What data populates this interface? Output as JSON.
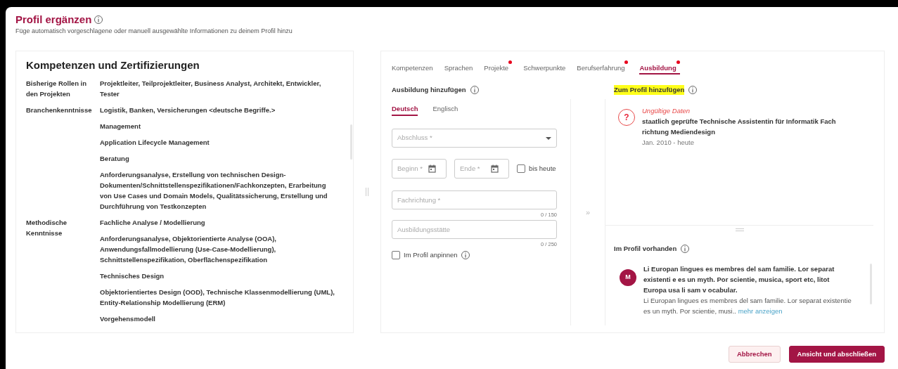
{
  "header": {
    "title": "Profil ergänzen",
    "subtitle": "Füge automatisch vorgeschlagene oder manuell ausgewählte Informationen zu deinem Profil hinzu"
  },
  "competences": {
    "title": "Kompetenzen und Zertifizierungen",
    "groups": [
      {
        "label": "Bisherige Rollen in den Projekten",
        "items": [
          "Projektleiter, Teilprojektleiter, Business Analyst, Architekt, Entwickler, Tester"
        ]
      },
      {
        "label": "Branchenkenntnisse",
        "items": [
          "Logistik, Banken, Versicherungen <deutsche Begriffe.>",
          "Management",
          "Application Lifecycle Management",
          "Beratung",
          "Anforderungsanalyse, Erstellung von technischen Design-Dokumenten/Schnittstellenspezifikationen/Fachkonzepten, Erarbeitung von Use Cases und Domain Models, Qualitätssicherung, Erstellung und Durchführung von Testkonzepten"
        ]
      },
      {
        "label": "Methodische Kenntnisse",
        "items": [
          "Fachliche Analyse / Modellierung",
          "Anforderungsanalyse, Objektorientierte Analyse (OOA), Anwendungsfallmodellierung (Use-Case-Modellierung), Schnittstellenspezifikation, Oberflächenspezifikation",
          "Technisches Design",
          "Objektorientiertes Design (OOD), Technische Klassenmodellierung (UML), Entity-Relationship Modellierung (ERM)",
          "Vorgehensmodell"
        ]
      }
    ]
  },
  "tabs": [
    {
      "label": "Kompetenzen",
      "selected": false,
      "alert": false
    },
    {
      "label": "Sprachen",
      "selected": false,
      "alert": false
    },
    {
      "label": "Projekte",
      "selected": false,
      "alert": true
    },
    {
      "label": "Schwerpunkte",
      "selected": false,
      "alert": false
    },
    {
      "label": "Berufserfahrung",
      "selected": false,
      "alert": true
    },
    {
      "label": "Ausbildung",
      "selected": true,
      "alert": true
    }
  ],
  "form": {
    "title": "Ausbildung hinzufügen",
    "languages": [
      {
        "label": "Deutsch",
        "selected": true
      },
      {
        "label": "Englisch",
        "selected": false
      }
    ],
    "degree": {
      "placeholder": "Abschluss *"
    },
    "start": {
      "placeholder": "Beginn *"
    },
    "end": {
      "placeholder": "Ende *"
    },
    "until_today": {
      "label": "bis heute",
      "checked": false
    },
    "field": {
      "placeholder": "Fachrichtung *",
      "counter": "0 / 150"
    },
    "school": {
      "placeholder": "Ausbildungsstätte",
      "counter": "0 / 250"
    },
    "pin": {
      "label": "Im Profil anpinnen",
      "checked": false
    }
  },
  "transfer": {
    "label": "»"
  },
  "to_add": {
    "title": "Zum Profil hinzufügen",
    "entries": [
      {
        "icon": "?",
        "status": "Ungültige Daten",
        "title": "staatlich geprüfte Technische Assistentin für Informatik Fach richtung Mediendesign",
        "period": "Jan. 2010 - heute"
      }
    ]
  },
  "existing": {
    "title": "Im Profil vorhanden",
    "entries": [
      {
        "avatar": "M",
        "title": "Li Europan lingues es membres del sam familie. Lor separat existenti e es un myth. Por scientie, musica, sport etc, litot Europa usa li sam v ocabular.",
        "text": "Li Europan lingues es membres del sam familie. Lor separat existentie es un myth. Por scientie, musi..",
        "more": "mehr anzeigen"
      }
    ]
  },
  "buttons": [
    {
      "label": "Abbrechen",
      "kind": "secondary"
    },
    {
      "label": "Ansicht und abschließen",
      "kind": "primary"
    }
  ]
}
